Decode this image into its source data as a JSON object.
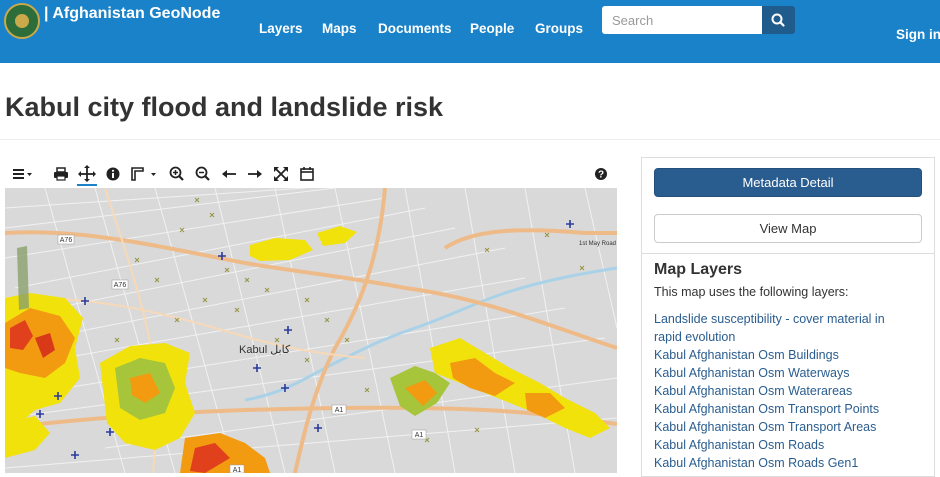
{
  "header": {
    "brand": "| Afghanistan GeoNode",
    "logo_icon": "afghanistan-emblem",
    "nav": [
      "Layers",
      "Maps",
      "Documents",
      "People",
      "Groups"
    ],
    "search_placeholder": "Search",
    "search_icon": "magnifier-icon",
    "signin": "Sign in",
    "bar_color": "#1a82c8"
  },
  "page": {
    "title": "Kabul city flood and landslide risk"
  },
  "toolbar": {
    "icons": [
      "menu-icon",
      "print-icon",
      "pan-icon",
      "info-icon",
      "legend-icon",
      "zoom-in-icon",
      "zoom-out-icon",
      "back-icon",
      "forward-icon",
      "fullscreen-icon",
      "calendar-icon",
      "help-icon"
    ]
  },
  "map": {
    "city_label": "Kabul کابل",
    "road_labels": [
      "A76",
      "A76",
      "A1",
      "A1",
      "A1",
      "1st May Road"
    ]
  },
  "sidebar": {
    "metadata_button": "Metadata Detail",
    "view_map_button": "View Map",
    "layers_title": "Map Layers",
    "layers_desc": "This map uses the following layers:",
    "layers": [
      "Landslide susceptibility - cover material in rapid evolution",
      "Kabul Afghanistan Osm Buildings",
      "Kabul Afghanistan Osm Waterways",
      "Kabul Afghanistan Osm Waterareas",
      "Kabul Afghanistan Osm Transport Points",
      "Kabul Afghanistan Osm Transport Areas",
      "Kabul Afghanistan Osm Roads",
      "Kabul Afghanistan Osm Roads Gen1"
    ],
    "link_color": "#2a5d8f"
  }
}
